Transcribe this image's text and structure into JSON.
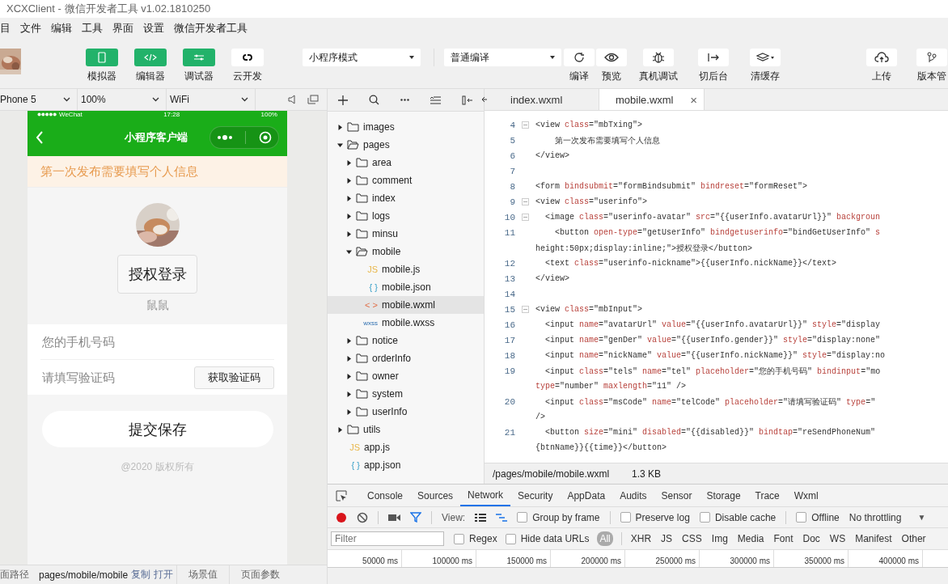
{
  "window": {
    "title": "XCXClient - 微信开发者工具 v1.02.1810250"
  },
  "menu": [
    "目",
    "文件",
    "编辑",
    "工具",
    "界面",
    "设置",
    "微信开发者工具"
  ],
  "toolbar": {
    "views": [
      {
        "label": "模拟器",
        "on": true
      },
      {
        "label": "编辑器",
        "on": true
      },
      {
        "label": "调试器",
        "on": true
      },
      {
        "label": "云开发",
        "on": false
      }
    ],
    "mode": "小程序模式",
    "compile": "普通编译",
    "actions": [
      "编译",
      "预览",
      "真机调试",
      "切后台",
      "清缓存",
      "上传",
      "版本管"
    ]
  },
  "simulator": {
    "device": "Phone 5",
    "zoom": "100%",
    "network": "WiFi",
    "status": {
      "carrier": "WeChat",
      "time": "17:28",
      "battery": "100%"
    },
    "nav_title": "小程序客户端",
    "notice": "第一次发布需要填写个人信息",
    "login_button": "授权登录",
    "nickname": "鼠鼠",
    "fields": [
      {
        "placeholder": "您的手机号码"
      },
      {
        "placeholder": "请填写验证码",
        "button": "获取验证码"
      }
    ],
    "submit": "提交保存",
    "footer": "@2020 版权所有"
  },
  "sim_status": {
    "path_label": "面路径",
    "path": "pages/mobile/mobile",
    "links": [
      "复制",
      "打开"
    ],
    "tabs": [
      "场景值",
      "页面参数"
    ]
  },
  "file_tree": [
    {
      "name": "images",
      "kind": "folder",
      "expanded": false,
      "selected": false
    },
    {
      "name": "pages",
      "kind": "folder",
      "expanded": true,
      "selected": false,
      "children": [
        {
          "name": "area",
          "kind": "folder",
          "expanded": false,
          "selected": false
        },
        {
          "name": "comment",
          "kind": "folder",
          "expanded": false,
          "selected": false
        },
        {
          "name": "index",
          "kind": "folder",
          "expanded": false,
          "selected": false
        },
        {
          "name": "logs",
          "kind": "folder",
          "expanded": false,
          "selected": false
        },
        {
          "name": "minsu",
          "kind": "folder",
          "expanded": false,
          "selected": false
        },
        {
          "name": "mobile",
          "kind": "folder",
          "expanded": true,
          "selected": false,
          "children": [
            {
              "name": "mobile.js",
              "kind": "js",
              "badge": "JS",
              "selected": false
            },
            {
              "name": "mobile.json",
              "kind": "json",
              "badge": "{ }",
              "selected": false
            },
            {
              "name": "mobile.wxml",
              "kind": "wxml",
              "badge": "< >",
              "selected": true
            },
            {
              "name": "mobile.wxss",
              "kind": "wxss",
              "badge": "wxss",
              "selected": false
            }
          ]
        },
        {
          "name": "notice",
          "kind": "folder",
          "expanded": false,
          "selected": false
        },
        {
          "name": "orderInfo",
          "kind": "folder",
          "expanded": false,
          "selected": false
        },
        {
          "name": "owner",
          "kind": "folder",
          "expanded": false,
          "selected": false
        },
        {
          "name": "system",
          "kind": "folder",
          "expanded": false,
          "selected": false
        },
        {
          "name": "userInfo",
          "kind": "folder",
          "expanded": false,
          "selected": false
        }
      ]
    },
    {
      "name": "utils",
      "kind": "folder",
      "expanded": false,
      "selected": false
    },
    {
      "name": "app.js",
      "kind": "js",
      "badge": "JS",
      "selected": false
    },
    {
      "name": "app.json",
      "kind": "json",
      "badge": "{ }",
      "selected": false
    }
  ],
  "editor": {
    "tabs": [
      {
        "label": "index.wxml",
        "selected": false,
        "closable": false
      },
      {
        "label": "mobile.wxml",
        "selected": true,
        "closable": true
      }
    ],
    "close_glyph": "×",
    "lines": [
      {
        "n": "4",
        "fold": true,
        "tokens": [
          {
            "kind": "tag",
            "text": "<view "
          },
          {
            "kind": "attr",
            "text": "class"
          },
          {
            "kind": "tag",
            "text": "=\"mbTxing\">"
          }
        ]
      },
      {
        "n": "5",
        "fold": false,
        "tokens": [
          {
            "kind": "tag",
            "text": "    第一次发布需要填写个人信息"
          }
        ]
      },
      {
        "n": "6",
        "fold": false,
        "tokens": [
          {
            "kind": "tag",
            "text": "</view>"
          }
        ]
      },
      {
        "n": "7",
        "fold": false
      },
      {
        "n": "8",
        "fold": false,
        "tokens": [
          {
            "kind": "tag",
            "text": "<form "
          },
          {
            "kind": "attr",
            "text": "bindsubmit"
          },
          {
            "kind": "tag",
            "text": "=\"formBindsubmit\" "
          },
          {
            "kind": "attr",
            "text": "bindreset"
          },
          {
            "kind": "tag",
            "text": "=\"formReset\">"
          }
        ]
      },
      {
        "n": "9",
        "fold": true,
        "tokens": [
          {
            "kind": "tag",
            "text": "<view "
          },
          {
            "kind": "attr",
            "text": "class"
          },
          {
            "kind": "tag",
            "text": "=\"userinfo\">"
          }
        ]
      },
      {
        "n": "10",
        "fold": true,
        "tokens": [
          {
            "kind": "tag",
            "text": "  <image "
          },
          {
            "kind": "attr",
            "text": "class"
          },
          {
            "kind": "tag",
            "text": "=\"userinfo-avatar\" "
          },
          {
            "kind": "attr",
            "text": "src"
          },
          {
            "kind": "tag",
            "text": "=\"{{userInfo.avatarUrl}}\" "
          },
          {
            "kind": "attr",
            "text": "backgroun"
          }
        ]
      },
      {
        "n": "11",
        "fold": false,
        "tokens": [
          {
            "kind": "tag",
            "text": "    <button "
          },
          {
            "kind": "attr",
            "text": "open-type"
          },
          {
            "kind": "tag",
            "text": "=\"getUserInfo\" "
          },
          {
            "kind": "attr",
            "text": "bindgetuserinfo"
          },
          {
            "kind": "tag",
            "text": "=\"bindGetUserInfo\" "
          },
          {
            "kind": "attr",
            "text": "s"
          }
        ]
      },
      {
        "fold": false,
        "tokens": [
          {
            "kind": "tag",
            "text": "height:50px;display:inline;\">授权登录</button>"
          }
        ]
      },
      {
        "n": "12",
        "fold": false,
        "tokens": [
          {
            "kind": "tag",
            "text": "  <text "
          },
          {
            "kind": "attr",
            "text": "class"
          },
          {
            "kind": "tag",
            "text": "=\"userinfo-nickname\">{{userInfo.nickName}}</text>"
          }
        ]
      },
      {
        "n": "13",
        "fold": false,
        "tokens": [
          {
            "kind": "tag",
            "text": "</view>"
          }
        ]
      },
      {
        "n": "14",
        "fold": false
      },
      {
        "n": "15",
        "fold": true,
        "tokens": [
          {
            "kind": "tag",
            "text": "<view "
          },
          {
            "kind": "attr",
            "text": "class"
          },
          {
            "kind": "tag",
            "text": "=\"mbInput\">"
          }
        ]
      },
      {
        "n": "16",
        "fold": false,
        "tokens": [
          {
            "kind": "tag",
            "text": "  <input "
          },
          {
            "kind": "attr",
            "text": "name"
          },
          {
            "kind": "tag",
            "text": "=\"avatarUrl\" "
          },
          {
            "kind": "attr",
            "text": "value"
          },
          {
            "kind": "tag",
            "text": "=\"{{userInfo.avatarUrl}}\" "
          },
          {
            "kind": "attr",
            "text": "style"
          },
          {
            "kind": "tag",
            "text": "=\"display"
          }
        ]
      },
      {
        "n": "17",
        "fold": false,
        "tokens": [
          {
            "kind": "tag",
            "text": "  <input "
          },
          {
            "kind": "attr",
            "text": "name"
          },
          {
            "kind": "tag",
            "text": "=\"genDer\" "
          },
          {
            "kind": "attr",
            "text": "value"
          },
          {
            "kind": "tag",
            "text": "=\"{{userInfo.gender}}\" "
          },
          {
            "kind": "attr",
            "text": "style"
          },
          {
            "kind": "tag",
            "text": "=\"display:none\""
          }
        ]
      },
      {
        "n": "18",
        "fold": false,
        "tokens": [
          {
            "kind": "tag",
            "text": "  <input "
          },
          {
            "kind": "attr",
            "text": "name"
          },
          {
            "kind": "tag",
            "text": "=\"nickName\" "
          },
          {
            "kind": "attr",
            "text": "value"
          },
          {
            "kind": "tag",
            "text": "=\"{{userInfo.nickName}}\" "
          },
          {
            "kind": "attr",
            "text": "style"
          },
          {
            "kind": "tag",
            "text": "=\"display:no"
          }
        ]
      },
      {
        "n": "19",
        "fold": false,
        "tokens": [
          {
            "kind": "tag",
            "text": "  <input "
          },
          {
            "kind": "attr",
            "text": "class"
          },
          {
            "kind": "tag",
            "text": "=\"tels\" "
          },
          {
            "kind": "attr",
            "text": "name"
          },
          {
            "kind": "tag",
            "text": "=\"tel\" "
          },
          {
            "kind": "attr",
            "text": "placeholder"
          },
          {
            "kind": "tag",
            "text": "=\"您的手机号码\" "
          },
          {
            "kind": "attr",
            "text": "bindinput"
          },
          {
            "kind": "tag",
            "text": "=\"mo"
          }
        ]
      },
      {
        "fold": false,
        "tokens": [
          {
            "kind": "attr",
            "text": "type"
          },
          {
            "kind": "tag",
            "text": "=\"number\" "
          },
          {
            "kind": "attr",
            "text": "maxlength"
          },
          {
            "kind": "tag",
            "text": "=\"11\" />"
          }
        ]
      },
      {
        "n": "20",
        "fold": false,
        "tokens": [
          {
            "kind": "tag",
            "text": "  <input "
          },
          {
            "kind": "attr",
            "text": "class"
          },
          {
            "kind": "tag",
            "text": "=\"msCode\" "
          },
          {
            "kind": "attr",
            "text": "name"
          },
          {
            "kind": "tag",
            "text": "=\"telCode\" "
          },
          {
            "kind": "attr",
            "text": "placeholder"
          },
          {
            "kind": "tag",
            "text": "=\"请填写验证码\" "
          },
          {
            "kind": "attr",
            "text": "type"
          },
          {
            "kind": "tag",
            "text": "=\""
          }
        ]
      },
      {
        "fold": false,
        "tokens": [
          {
            "kind": "tag",
            "text": "/>"
          }
        ]
      },
      {
        "n": "21",
        "fold": false,
        "tokens": [
          {
            "kind": "tag",
            "text": "  <button "
          },
          {
            "kind": "attr",
            "text": "size"
          },
          {
            "kind": "tag",
            "text": "=\"mini\" "
          },
          {
            "kind": "attr",
            "text": "disabled"
          },
          {
            "kind": "tag",
            "text": "=\"{{disabled}}\" "
          },
          {
            "kind": "attr",
            "text": "bindtap"
          },
          {
            "kind": "tag",
            "text": "=\"reSendPhoneNum\""
          }
        ]
      },
      {
        "fold": false,
        "tokens": [
          {
            "kind": "tag",
            "text": "{btnName}}{{time}}</button>"
          }
        ]
      }
    ],
    "path": "/pages/mobile/mobile.wxml",
    "size": "1.3 KB"
  },
  "devtools": {
    "tabs": [
      {
        "label": "Console",
        "selected": false
      },
      {
        "label": "Sources",
        "selected": false
      },
      {
        "label": "Network",
        "selected": true
      },
      {
        "label": "Security",
        "selected": false
      },
      {
        "label": "AppData",
        "selected": false
      },
      {
        "label": "Audits",
        "selected": false
      },
      {
        "label": "Sensor",
        "selected": false
      },
      {
        "label": "Storage",
        "selected": false
      },
      {
        "label": "Trace",
        "selected": false
      },
      {
        "label": "Wxml",
        "selected": false
      }
    ],
    "recording": true,
    "view_label": "View:",
    "options": [
      {
        "label": "Group by frame",
        "checked": false
      },
      {
        "label": "Preserve log",
        "checked": false
      },
      {
        "label": "Disable cache",
        "checked": false
      },
      {
        "label": "Offline",
        "checked": false
      }
    ],
    "throttling": "No throttling",
    "throttle_caret": "▼",
    "filter_placeholder": "Filter",
    "filter_options": [
      {
        "label": "Regex",
        "checked": false
      },
      {
        "label": "Hide data URLs",
        "checked": false
      }
    ],
    "types": [
      {
        "label": "All",
        "selected": true
      },
      {
        "label": "XHR",
        "selected": false
      },
      {
        "label": "JS",
        "selected": false
      },
      {
        "label": "CSS",
        "selected": false
      },
      {
        "label": "Img",
        "selected": false
      },
      {
        "label": "Media",
        "selected": false
      },
      {
        "label": "Font",
        "selected": false
      },
      {
        "label": "Doc",
        "selected": false
      },
      {
        "label": "WS",
        "selected": false
      },
      {
        "label": "Manifest",
        "selected": false
      },
      {
        "label": "Other",
        "selected": false
      }
    ],
    "timeline": [
      "50000 ms",
      "100000 ms",
      "150000 ms",
      "200000 ms",
      "250000 ms",
      "300000 ms",
      "350000 ms",
      "400000 ms"
    ]
  }
}
